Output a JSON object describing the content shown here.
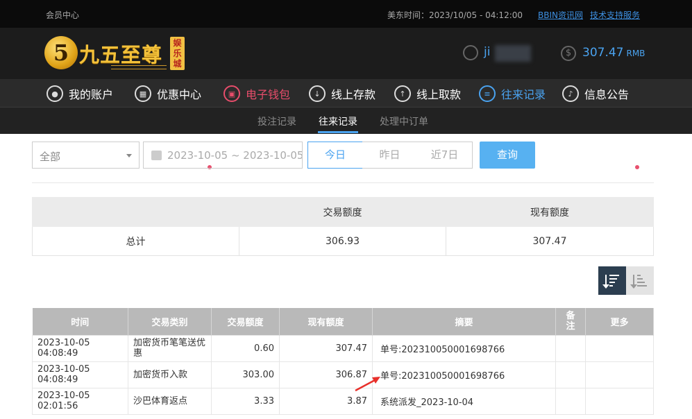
{
  "topbar": {
    "member_center": "会员中心",
    "time": "美东时间：2023/10/05 - 04:12:00",
    "link1": "BBIN资讯网",
    "link2": "技术支持服务"
  },
  "header": {
    "logo_mark": "5",
    "logo_text": "九五至尊",
    "logo_tag": "娱乐城",
    "username": "ji",
    "balance": "307.47",
    "balance_unit": "RMB",
    "balance_symbol": "$"
  },
  "nav": [
    {
      "label": "我的账户",
      "icon": "user-icon"
    },
    {
      "label": "优惠中心",
      "icon": "gift-icon"
    },
    {
      "label": "电子钱包",
      "icon": "wallet-icon"
    },
    {
      "label": "线上存款",
      "icon": "deposit-icon"
    },
    {
      "label": "线上取款",
      "icon": "withdraw-icon"
    },
    {
      "label": "往来记录",
      "icon": "record-icon"
    },
    {
      "label": "信息公告",
      "icon": "bell-icon"
    }
  ],
  "subnav": {
    "bet_records": "投注记录",
    "transactions": "往来记录",
    "pending_orders": "处理中订单"
  },
  "filter": {
    "type_selected": "全部",
    "date_range": "2023-10-05 ~ 2023-10-05",
    "today": "今日",
    "yesterday": "昨日",
    "last7": "近7日",
    "query": "查询"
  },
  "summary": {
    "col_amount": "交易额度",
    "col_balance": "现有额度",
    "row_label": "总计",
    "total_amount": "306.93",
    "total_balance": "307.47"
  },
  "records": {
    "headers": [
      "时间",
      "交易类别",
      "交易额度",
      "现有额度",
      "摘要",
      "备注",
      "更多"
    ],
    "rows": [
      {
        "time": "2023-10-05 04:08:49",
        "category": "加密货币笔笔送优惠",
        "amount": "0.60",
        "balance": "307.47",
        "summary": "单号:202310050001698766"
      },
      {
        "time": "2023-10-05 04:08:49",
        "category": "加密货币入款",
        "amount": "303.00",
        "balance": "306.87",
        "summary": "单号:202310050001698766"
      },
      {
        "time": "2023-10-05 02:01:56",
        "category": "沙巴体育返点",
        "amount": "3.33",
        "balance": "3.87",
        "summary": "系统派发_2023-10-04"
      }
    ]
  },
  "colors": {
    "accent_blue": "#4aa3f0",
    "accent_red": "#e84d6b",
    "header_bg": "#1c1c1c"
  }
}
